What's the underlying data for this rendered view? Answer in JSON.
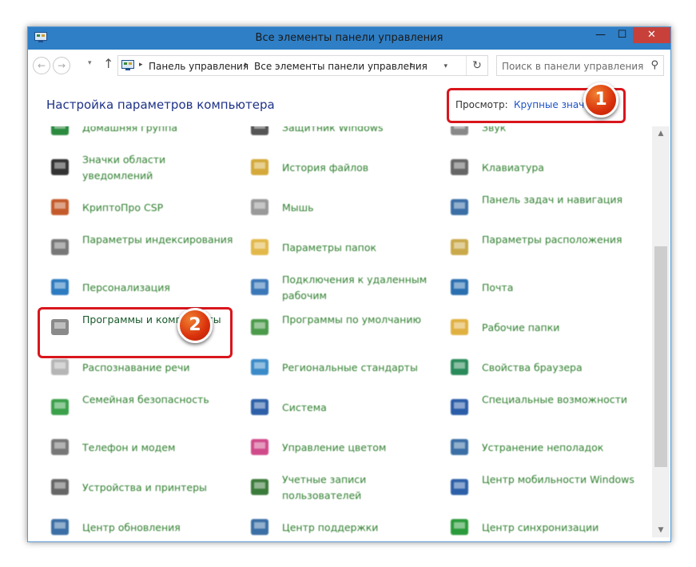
{
  "window": {
    "title": "Все элементы панели управления",
    "controls": {
      "minimize": "—",
      "maximize": "☐",
      "close": "✕"
    }
  },
  "navbar": {
    "back_icon": "←",
    "forward_icon": "→",
    "recent_icon": "▾",
    "up_icon": "↑",
    "breadcrumb": [
      "Панель управления",
      "Все элементы панели управления"
    ],
    "crumb_sep": "▸",
    "dropdown_icon": "▾",
    "refresh_icon": "↻",
    "search_placeholder": "Поиск в панели управления",
    "search_icon": "⚲"
  },
  "header": {
    "title": "Настройка параметров компьютера",
    "view_label": "Просмотр:",
    "view_value": "Крупные значки",
    "view_caret": "▾"
  },
  "callouts": [
    "1",
    "2"
  ],
  "items": [
    {
      "label": "Домашняя группа",
      "icon": "homegroup-icon",
      "color": "#2a8a3e"
    },
    {
      "label": "Защитник Windows",
      "icon": "defender-icon",
      "color": "#555555"
    },
    {
      "label": "Звук",
      "icon": "sound-icon",
      "color": "#888888"
    },
    {
      "label": "Значки области уведомлений",
      "icon": "notification-icons-icon",
      "color": "#333333"
    },
    {
      "label": "История файлов",
      "icon": "file-history-icon",
      "color": "#d4a93a"
    },
    {
      "label": "Клавиатура",
      "icon": "keyboard-icon",
      "color": "#666666"
    },
    {
      "label": "КриптоПро CSP",
      "icon": "cryptopro-icon",
      "color": "#c45a2a"
    },
    {
      "label": "Мышь",
      "icon": "mouse-icon",
      "color": "#999999"
    },
    {
      "label": "Панель задач и навигация",
      "icon": "taskbar-icon",
      "color": "#3a6ea5"
    },
    {
      "label": "Параметры индексирования",
      "icon": "indexing-icon",
      "color": "#777777"
    },
    {
      "label": "Параметры папок",
      "icon": "folder-options-icon",
      "color": "#e2b84a"
    },
    {
      "label": "Параметры расположения",
      "icon": "location-icon",
      "color": "#c9a94a"
    },
    {
      "label": "Персонализация",
      "icon": "personalization-icon",
      "color": "#2c7ac0"
    },
    {
      "label": "Подключения к удаленным рабочим",
      "icon": "remote-desktop-icon",
      "color": "#3a77b8"
    },
    {
      "label": "Почта",
      "icon": "mail-icon",
      "color": "#2a6fb0"
    },
    {
      "label": "Программы и компоненты",
      "icon": "programs-features-icon",
      "color": "#8a8a8a"
    },
    {
      "label": "Программы по умолчанию",
      "icon": "default-programs-icon",
      "color": "#4a9a4a"
    },
    {
      "label": "Рабочие папки",
      "icon": "work-folders-icon",
      "color": "#e0b040"
    },
    {
      "label": "Распознавание речи",
      "icon": "microphone-icon",
      "color": "#b5b5b5"
    },
    {
      "label": "Региональные стандарты",
      "icon": "region-icon",
      "color": "#3a8ac8"
    },
    {
      "label": "Свойства браузера",
      "icon": "internet-options-icon",
      "color": "#2a8a5a"
    },
    {
      "label": "Семейная безопасность",
      "icon": "family-safety-icon",
      "color": "#3aa04a"
    },
    {
      "label": "Система",
      "icon": "system-icon",
      "color": "#2c5fa8"
    },
    {
      "label": "Специальные возможности",
      "icon": "accessibility-icon",
      "color": "#2a5ca8"
    },
    {
      "label": "Телефон и модем",
      "icon": "phone-modem-icon",
      "color": "#777777"
    },
    {
      "label": "Управление цветом",
      "icon": "color-management-icon",
      "color": "#d04a8a"
    },
    {
      "label": "Устранение неполадок",
      "icon": "troubleshooting-icon",
      "color": "#3a6ea5"
    },
    {
      "label": "Устройства и принтеры",
      "icon": "devices-printers-icon",
      "color": "#666666"
    },
    {
      "label": "Учетные записи пользователей",
      "icon": "user-accounts-icon",
      "color": "#3a7a3a"
    },
    {
      "label": "Центр мобильности Windows",
      "icon": "mobility-center-icon",
      "color": "#2c5fa8"
    },
    {
      "label": "Центр обновления",
      "icon": "windows-update-icon",
      "color": "#3a6ea5"
    },
    {
      "label": "Центр поддержки",
      "icon": "action-center-icon",
      "color": "#3a6ea5"
    },
    {
      "label": "Центр синхронизации",
      "icon": "sync-center-icon",
      "color": "#2a9a3a"
    }
  ],
  "scrollbar": {
    "up": "▲",
    "down": "▼"
  }
}
